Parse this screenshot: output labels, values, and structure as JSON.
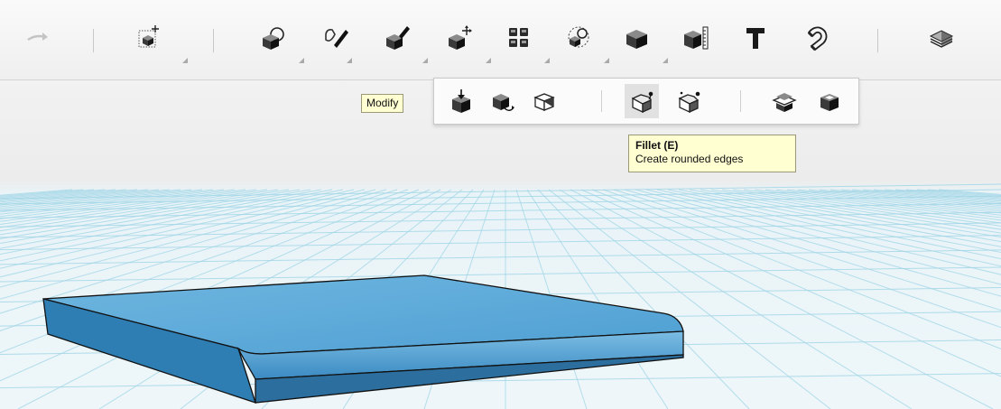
{
  "toolbar": {
    "buttons": [
      {
        "id": "redo",
        "icon": "redo-arrow-icon"
      },
      {
        "id": "transform",
        "icon": "transform-icon"
      },
      {
        "id": "primitives",
        "icon": "primitives-icon"
      },
      {
        "id": "sketch",
        "icon": "sketch-icon"
      },
      {
        "id": "construct",
        "icon": "construct-icon"
      },
      {
        "id": "modify",
        "icon": "modify-icon"
      },
      {
        "id": "pattern",
        "icon": "pattern-icon"
      },
      {
        "id": "grouping",
        "icon": "grouping-icon"
      },
      {
        "id": "combine",
        "icon": "combine-icon"
      },
      {
        "id": "measure",
        "icon": "measure-icon"
      },
      {
        "id": "text",
        "icon": "text-icon"
      },
      {
        "id": "snap",
        "icon": "snap-icon"
      },
      {
        "id": "material",
        "icon": "material-icon"
      }
    ]
  },
  "tooltip_modify": {
    "label": "Modify"
  },
  "submenu": {
    "items": [
      {
        "id": "press-pull",
        "icon": "press-pull-icon"
      },
      {
        "id": "tweak",
        "icon": "tweak-icon"
      },
      {
        "id": "split-face",
        "icon": "split-face-icon"
      },
      {
        "id": "fillet",
        "icon": "fillet-icon",
        "active": true
      },
      {
        "id": "chamfer",
        "icon": "chamfer-icon"
      },
      {
        "id": "split-solid",
        "icon": "split-solid-icon"
      },
      {
        "id": "shell",
        "icon": "shell-icon"
      }
    ]
  },
  "tooltip_fillet": {
    "title": "Fillet (E)",
    "description": "Create rounded edges"
  },
  "colors": {
    "grid_line": "#9fd4e6",
    "model_top": "#5aaad8",
    "model_front": "#2f7fb4",
    "tooltip_bg": "#ffffd2"
  }
}
